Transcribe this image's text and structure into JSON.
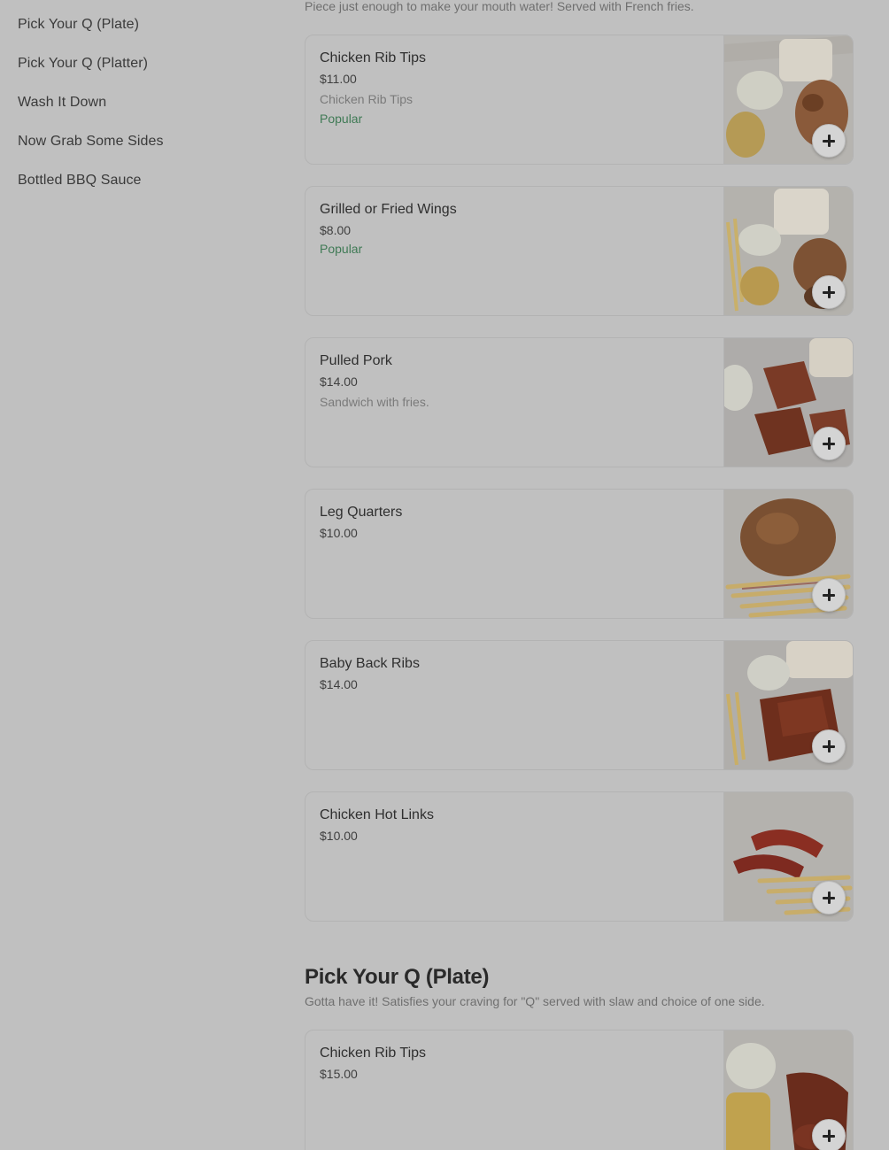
{
  "sidebar": {
    "items": [
      {
        "label": "Pick Your Q (Plate)"
      },
      {
        "label": "Pick Your Q (Platter)"
      },
      {
        "label": "Wash It Down"
      },
      {
        "label": "Now Grab Some Sides"
      },
      {
        "label": "Bottled BBQ Sauce"
      }
    ]
  },
  "section_top": {
    "description": "Piece just enough to make your mouth water! Served with French fries."
  },
  "items": [
    {
      "title": "Chicken Rib Tips",
      "price": "$11.00",
      "description": "Chicken Rib Tips",
      "badge": "Popular",
      "image": "rib-tips-plate-photo"
    },
    {
      "title": "Grilled or Fried Wings",
      "price": "$8.00",
      "badge": "Popular",
      "image": "wings-plate-photo"
    },
    {
      "title": "Pulled Pork",
      "price": "$14.00",
      "description": "Sandwich with fries.",
      "image": "pulled-pork-photo"
    },
    {
      "title": "Leg Quarters",
      "price": "$10.00",
      "image": "leg-quarters-photo"
    },
    {
      "title": "Baby Back Ribs",
      "price": "$14.00",
      "image": "baby-back-ribs-photo"
    },
    {
      "title": "Chicken Hot Links",
      "price": "$10.00",
      "image": "hot-links-photo"
    }
  ],
  "section_plate": {
    "title": "Pick Your Q (Plate)",
    "description": "Gotta have it! Satisfies your craving for \"Q\" served with slaw and choice of one side.",
    "items": [
      {
        "title": "Chicken Rib Tips",
        "price": "$15.00",
        "image": "rib-tips-plate-photo"
      }
    ]
  },
  "colors": {
    "overlay_bg": "#c0c0c0",
    "popular_badge": "#3f7a55",
    "card_border": "#b3b3b3"
  },
  "icons": {
    "add": "plus-icon"
  }
}
